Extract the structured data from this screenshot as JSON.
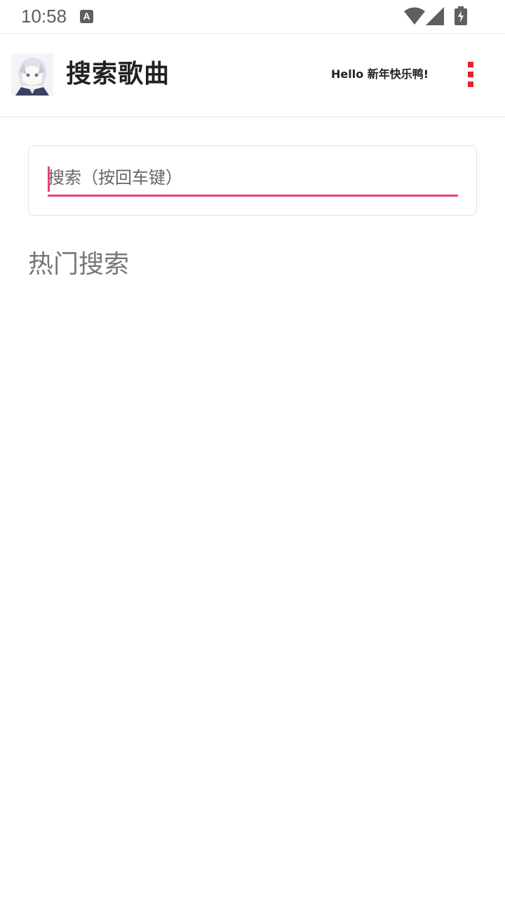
{
  "status_bar": {
    "time": "10:58",
    "notification_icon": "a-letter-icon",
    "notification_letter": "A",
    "icons": [
      "wifi-icon",
      "cellular-signal-icon",
      "battery-charging-icon"
    ]
  },
  "app_bar": {
    "title": "搜索歌曲",
    "greeting": "Hello 新年快乐鸭!",
    "avatar_icon": "anime-avatar",
    "menu_icon": "more-vertical-icon",
    "accent_color": "#e8202a"
  },
  "search": {
    "placeholder": "搜索（按回车键）",
    "value": "",
    "underline_color": "#ec407a"
  },
  "hot_search": {
    "title": "热门搜索",
    "items": []
  }
}
